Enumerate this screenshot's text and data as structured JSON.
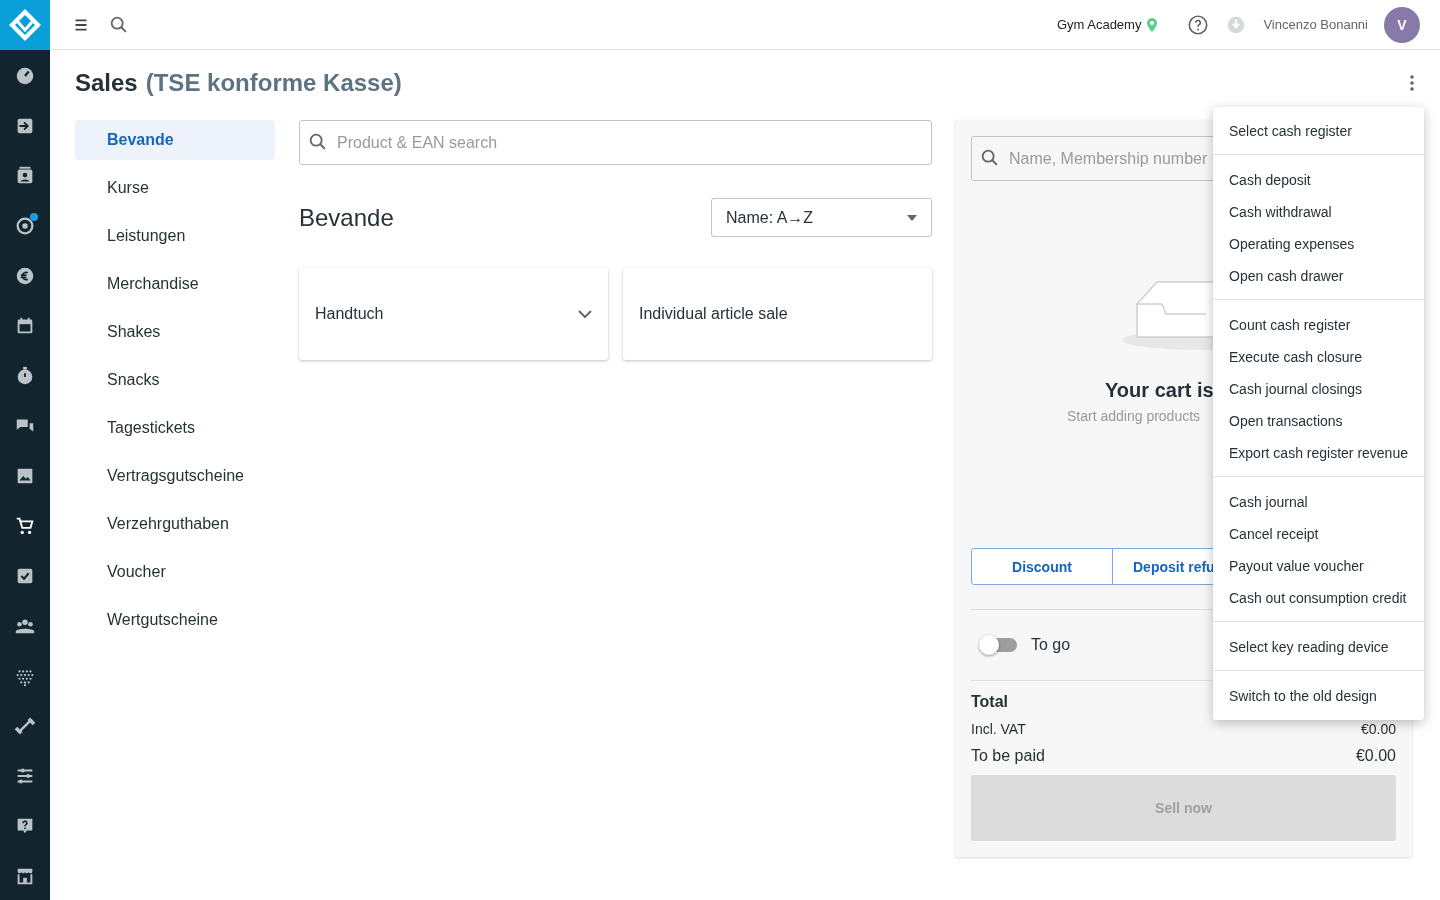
{
  "sidebar": {
    "items": [
      {
        "selected": false,
        "notification": false
      },
      {
        "selected": false,
        "notification": false
      },
      {
        "selected": false,
        "notification": false
      },
      {
        "selected": false,
        "notification": true
      },
      {
        "selected": false,
        "notification": false
      },
      {
        "selected": false,
        "notification": false
      },
      {
        "selected": false,
        "notification": false
      },
      {
        "selected": false,
        "notification": false
      },
      {
        "selected": false,
        "notification": false
      },
      {
        "selected": true,
        "notification": false
      },
      {
        "selected": false,
        "notification": false
      },
      {
        "selected": false,
        "notification": false
      },
      {
        "selected": false,
        "notification": false
      },
      {
        "selected": false,
        "notification": false
      },
      {
        "selected": false,
        "notification": false
      },
      {
        "selected": false,
        "notification": false
      },
      {
        "selected": false,
        "notification": false
      }
    ]
  },
  "topbar": {
    "studio": "Gym Academy",
    "user": "Vincenzo Bonanni",
    "avatar": "V"
  },
  "page": {
    "title": "Sales",
    "subtitle": "(TSE konforme Kasse)"
  },
  "categories": [
    {
      "label": "Bevande",
      "selected": true
    },
    {
      "label": "Kurse",
      "selected": false
    },
    {
      "label": "Leistungen",
      "selected": false
    },
    {
      "label": "Merchandise",
      "selected": false
    },
    {
      "label": "Shakes",
      "selected": false
    },
    {
      "label": "Snacks",
      "selected": false
    },
    {
      "label": "Tagestickets",
      "selected": false
    },
    {
      "label": "Vertragsgutscheine",
      "selected": false
    },
    {
      "label": "Verzehrguthaben",
      "selected": false
    },
    {
      "label": "Voucher",
      "selected": false
    },
    {
      "label": "Wertgutscheine",
      "selected": false
    }
  ],
  "products": {
    "search": {
      "placeholder": "Product & EAN search"
    },
    "heading": "Bevande",
    "sort": "Name: A→Z",
    "cards": [
      {
        "label": "Handtuch",
        "expandable": true
      },
      {
        "label": "Individual article sale",
        "expandable": false
      }
    ]
  },
  "cart": {
    "search": {
      "placeholder": "Name, Membership number"
    },
    "empty_title": "Your cart is",
    "empty_text": "Start adding products",
    "buttons": [
      "Discount",
      "Deposit refu"
    ],
    "to_go": {
      "label": "To go",
      "on": false
    },
    "total_label": "Total",
    "rows": [
      {
        "label": "Incl. VAT",
        "value": "€0.00"
      },
      {
        "label": "To be paid",
        "value": "€0.00"
      }
    ],
    "sell": {
      "label": "Sell now",
      "disabled": true
    }
  },
  "menu": {
    "groups": [
      [
        "Select cash register"
      ],
      [
        "Cash deposit",
        "Cash withdrawal",
        "Operating expenses",
        "Open cash drawer"
      ],
      [
        "Count cash register",
        "Execute cash closure",
        "Cash journal closings",
        "Open transactions",
        "Export cash register revenue"
      ],
      [
        "Cash journal",
        "Cancel receipt",
        "Payout value voucher",
        "Cash out consumption credit"
      ],
      [
        "Select key reading device"
      ],
      [
        "Switch to the old design"
      ]
    ]
  }
}
